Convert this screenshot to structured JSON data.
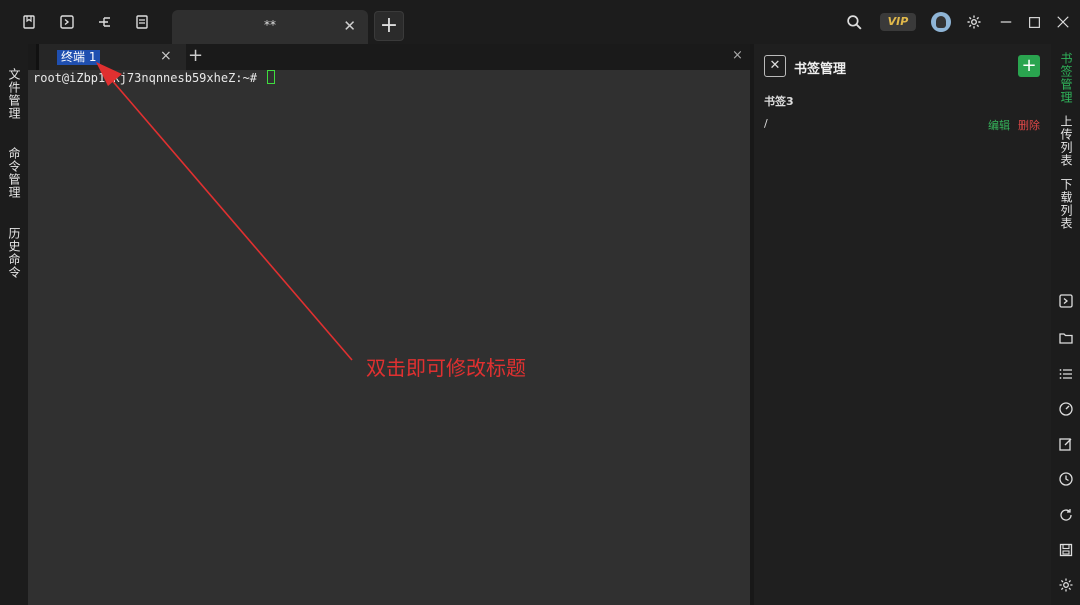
{
  "titlebar": {
    "tab_title": "**",
    "tab_close": "✕",
    "new_tab": "+",
    "vip_label": "VIP"
  },
  "left_sidebar": {
    "items": [
      "文件管理",
      "命令管理",
      "历史命令"
    ]
  },
  "terminal_tabs": {
    "active_label": "终端 1",
    "close": "×",
    "add": "+",
    "pane_close": "×"
  },
  "terminal": {
    "prompt": "root@iZbp1skj73nqnnesb59xheZ:~# "
  },
  "annotation": {
    "text": "双击即可修改标题",
    "color": "#e03030"
  },
  "bookmark_panel": {
    "title": "书签管理",
    "close": "✕",
    "add": "+",
    "group": "书签3",
    "items": [
      {
        "path": "/",
        "edit_label": "编辑",
        "delete_label": "删除"
      }
    ]
  },
  "right_sidebar": {
    "tabs": [
      {
        "label": "书签管理",
        "active": true
      },
      {
        "label": "上传列表",
        "active": false
      },
      {
        "label": "下载列表",
        "active": false
      }
    ],
    "icons": [
      "terminal-icon",
      "folder-icon",
      "list-icon",
      "gauge-icon",
      "edit-icon",
      "history-icon",
      "refresh-icon",
      "save-icon",
      "settings-icon"
    ]
  },
  "colors": {
    "accent_green": "#2aa44f",
    "tab_highlight": "#1f4fb0",
    "danger": "#e04848",
    "vip_gold": "#e0b84a"
  }
}
